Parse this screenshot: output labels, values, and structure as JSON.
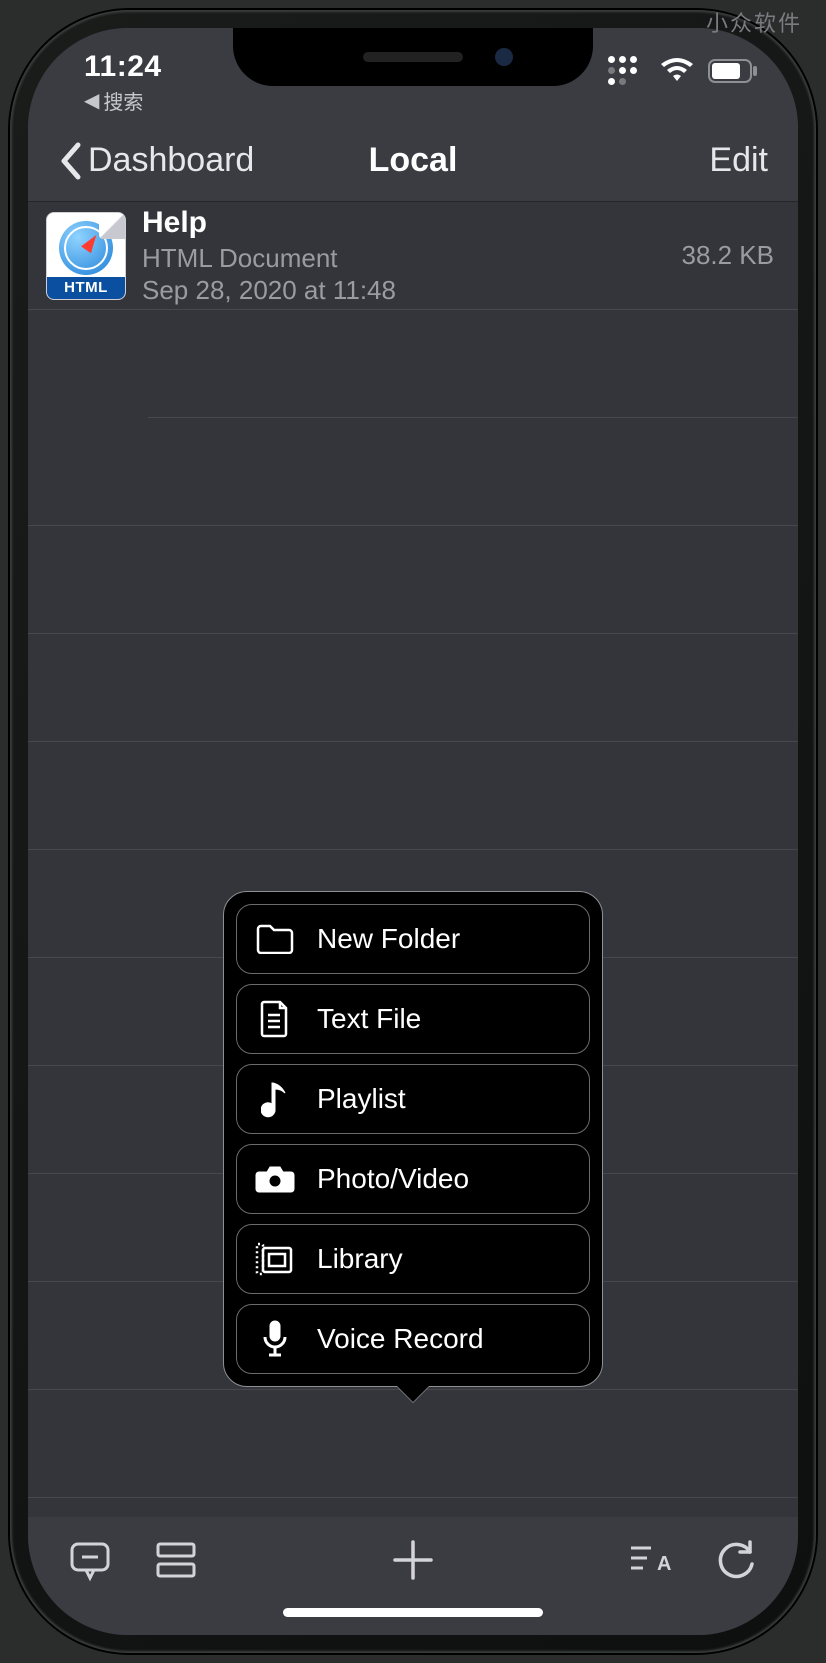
{
  "watermark": "小众软件",
  "statusbar": {
    "time": "11:24",
    "breadcrumb_prefix": "◀",
    "breadcrumb": "搜索"
  },
  "navbar": {
    "back_label": "Dashboard",
    "title": "Local",
    "edit_label": "Edit"
  },
  "file": {
    "icon_label": "HTML",
    "name": "Help",
    "kind": "HTML Document",
    "date": "Sep 28, 2020 at 11:48",
    "size": "38.2 KB"
  },
  "popup": {
    "items": [
      {
        "icon": "folder-icon",
        "label": "New Folder"
      },
      {
        "icon": "textfile-icon",
        "label": "Text File"
      },
      {
        "icon": "music-note-icon",
        "label": "Playlist"
      },
      {
        "icon": "camera-icon",
        "label": "Photo/Video"
      },
      {
        "icon": "library-icon",
        "label": "Library"
      },
      {
        "icon": "microphone-icon",
        "label": "Voice Record"
      }
    ]
  }
}
